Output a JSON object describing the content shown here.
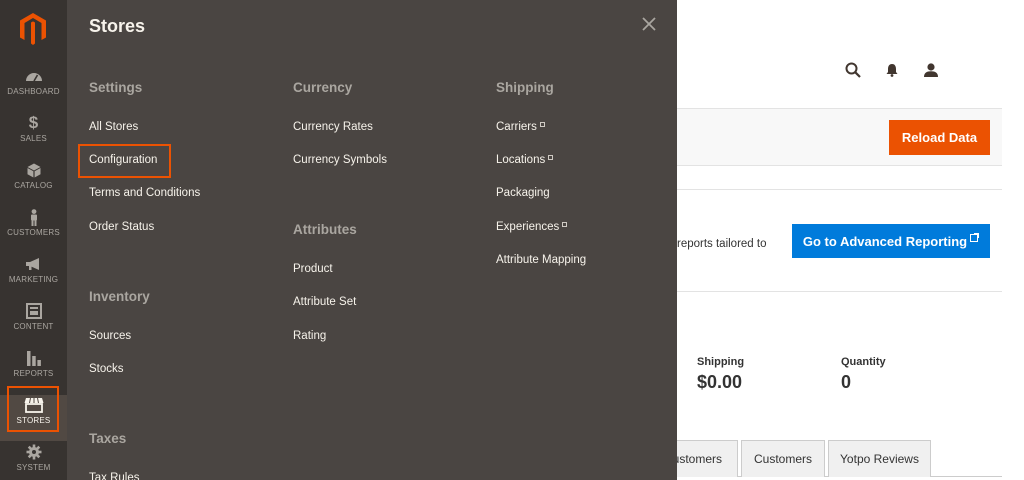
{
  "sidebar": {
    "items": [
      {
        "label": "DASHBOARD",
        "icon": "dashboard-icon"
      },
      {
        "label": "SALES",
        "icon": "dollar-icon"
      },
      {
        "label": "CATALOG",
        "icon": "cube-icon"
      },
      {
        "label": "CUSTOMERS",
        "icon": "person-icon"
      },
      {
        "label": "MARKETING",
        "icon": "megaphone-icon"
      },
      {
        "label": "CONTENT",
        "icon": "layout-icon"
      },
      {
        "label": "REPORTS",
        "icon": "bars-icon"
      },
      {
        "label": "STORES",
        "icon": "storefront-icon"
      },
      {
        "label": "SYSTEM",
        "icon": "gear-icon"
      }
    ],
    "active": "STORES",
    "highlight_color": "#eb5202"
  },
  "flyout": {
    "title": "Stores",
    "settings": {
      "heading": "Settings",
      "items": [
        "All Stores",
        "Configuration",
        "Terms and Conditions",
        "Order Status"
      ]
    },
    "inventory": {
      "heading": "Inventory",
      "items": [
        "Sources",
        "Stocks"
      ]
    },
    "taxes": {
      "heading": "Taxes",
      "items": [
        "Tax Rules"
      ]
    },
    "currency": {
      "heading": "Currency",
      "items": [
        "Currency Rates",
        "Currency Symbols"
      ]
    },
    "attributes": {
      "heading": "Attributes",
      "items": [
        "Product",
        "Attribute Set",
        "Rating"
      ]
    },
    "shipping": {
      "heading": "Shipping",
      "items": [
        "Carriers",
        "Locations",
        "Packaging",
        "Experiences",
        "Attribute Mapping"
      ]
    }
  },
  "page": {
    "reload_label": "Reload Data",
    "reports_text": "reports tailored to",
    "advanced_label": "Go to Advanced Reporting",
    "shipping_label": "Shipping",
    "shipping_value": "$0.00",
    "quantity_label": "Quantity",
    "quantity_value": "0",
    "tabs": [
      "ustomers",
      "Customers",
      "Yotpo Reviews"
    ]
  },
  "colors": {
    "sidebar_bg": "#373330",
    "flyout_bg": "#4a4542",
    "accent": "#eb5202",
    "link_blue": "#007bdb"
  }
}
